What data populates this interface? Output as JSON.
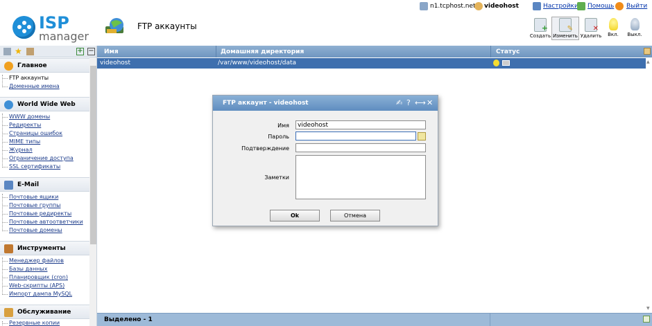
{
  "top": {
    "host_label": "n1.tcphost.net ::",
    "user": "videohost",
    "settings": "Настройки",
    "help": "Помощь",
    "logout": "Выйти"
  },
  "logo": {
    "brand": "ISP",
    "product": "manager"
  },
  "page": {
    "title": "FTP аккаунты"
  },
  "toolbar": {
    "create": "Создать",
    "edit": "Изменить",
    "delete": "Удалить",
    "enable": "Вкл.",
    "disable": "Выкл."
  },
  "sidebar": {
    "sections": [
      {
        "title": "Главное",
        "items": [
          "FTP аккаунты",
          "Доменные имена"
        ]
      },
      {
        "title": "World Wide Web",
        "items": [
          "WWW домены",
          "Редиректы",
          "Страницы ошибок",
          "MIME типы",
          "Журнал",
          "Ограничение доступа",
          "SSL сертификаты"
        ]
      },
      {
        "title": "E-Mail",
        "items": [
          "Почтовые ящики",
          "Почтовые группы",
          "Почтовые редиректы",
          "Почтовые автоответчики",
          "Почтовые домены"
        ]
      },
      {
        "title": "Инструменты",
        "items": [
          "Менеджер файлов",
          "Базы данных",
          "Планировщик (cron)",
          "Web-скрипты (APS)",
          "Импорт дампа MySQL"
        ]
      },
      {
        "title": "Обслуживание",
        "items": [
          "Резервные копии"
        ]
      }
    ]
  },
  "table": {
    "columns": [
      "Имя",
      "Домашняя директория",
      "Статус"
    ],
    "rows": [
      {
        "name": "videohost",
        "home": "/var/www/videohost/data"
      }
    ],
    "footer": "Выделено - 1"
  },
  "dialog": {
    "title": "FTP аккаунт - videohost",
    "controls": {
      "pin": "✍",
      "help": "?",
      "expand": "⟷",
      "close": "✕"
    },
    "fields": {
      "name_label": "Имя",
      "name_value": "videohost",
      "password_label": "Пароль",
      "confirm_label": "Подтверждение",
      "notes_label": "Заметки"
    },
    "ok": "Ok",
    "cancel": "Отмена"
  },
  "colors": {
    "header_blue": "#6f96c0",
    "row_selected": "#3e6fae",
    "logo_blue": "#1f8fd8",
    "link": "#1a3a8a"
  }
}
